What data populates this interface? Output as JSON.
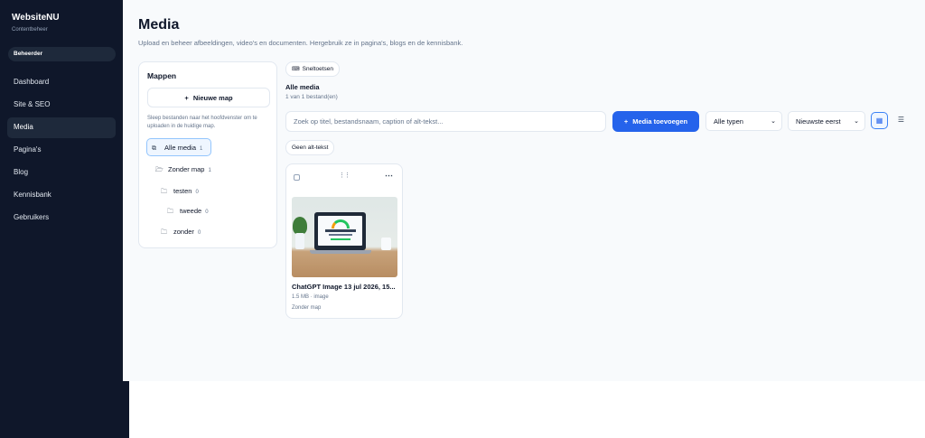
{
  "sidebar": {
    "brand": "WebsiteNU",
    "brand_sub": "Contentbeheer",
    "role": "Beheerder",
    "items": [
      {
        "label": "Dashboard"
      },
      {
        "label": "Site & SEO"
      },
      {
        "label": "Media",
        "active": true
      },
      {
        "label": "Pagina's"
      },
      {
        "label": "Blog"
      },
      {
        "label": "Kennisbank"
      },
      {
        "label": "Gebruikers"
      }
    ]
  },
  "header": {
    "title": "Media",
    "subtitle": "Upload en beheer afbeeldingen, video's en documenten. Hergebruik ze in pagina's, blogs en de kennisbank."
  },
  "folders": {
    "title": "Mappen",
    "new_folder_label": "Nieuwe map",
    "hint": "Sleep bestanden naar het hoofdvenster om te uploaden in de huidige map.",
    "items": [
      {
        "label": "Alle media",
        "count": "1",
        "icon": "stack-icon",
        "active": true
      },
      {
        "label": "Zonder map",
        "count": "1",
        "icon": "folder-open-icon"
      },
      {
        "label": "testen",
        "count": "0",
        "icon": "folder-icon"
      },
      {
        "label": "tweede",
        "count": "0",
        "icon": "folder-icon"
      },
      {
        "label": "zonder",
        "count": "0",
        "icon": "folder-icon"
      }
    ]
  },
  "toolbar": {
    "shortcuts_label": "Sneltoetsen",
    "section_title": "Alle media",
    "section_count": "1 van 1 bestand(en)",
    "search_placeholder": "Zoek op titel, bestandsnaam, caption of alt-tekst...",
    "add_media_label": "Media toevoegen",
    "type_filter": "Alle typen",
    "sort": "Nieuwste eerst",
    "filter_chip": "Geen alt-tekst",
    "accent_color": "#2563eb"
  },
  "media": [
    {
      "title": "ChatGPT Image 13 jul 2026, 15...",
      "meta": "1.5 MB · image",
      "folder": "Zonder map"
    }
  ]
}
